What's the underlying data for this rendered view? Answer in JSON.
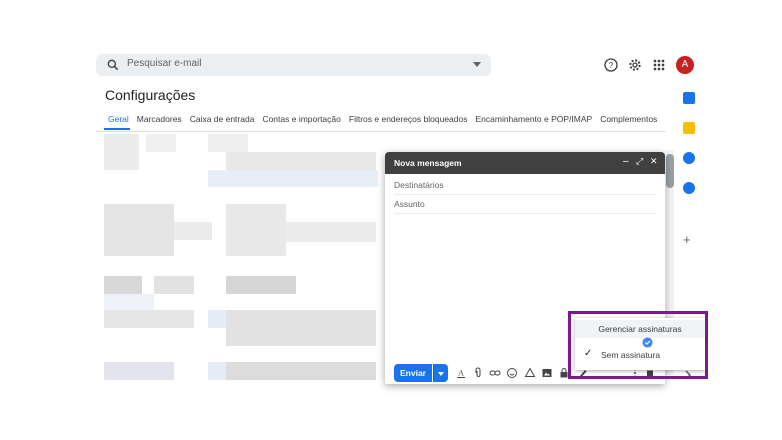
{
  "search": {
    "placeholder": "Pesquisar e-mail"
  },
  "header": {
    "avatar_letter": "A"
  },
  "page": {
    "title": "Configurações"
  },
  "tabs": [
    {
      "label": "Geral",
      "active": true
    },
    {
      "label": "Marcadores"
    },
    {
      "label": "Caixa de entrada"
    },
    {
      "label": "Contas e importação"
    },
    {
      "label": "Filtros e endereços bloqueados"
    },
    {
      "label": "Encaminhamento e POP/IMAP"
    },
    {
      "label": "Complementos"
    }
  ],
  "compose": {
    "title": "Nova mensagem",
    "to_label": "Destinatários",
    "subject_label": "Assunto",
    "send_label": "Enviar"
  },
  "signature_menu": {
    "manage_label": "Gerenciar assinaturas",
    "none_label": "Sem assinatura"
  },
  "colors": {
    "accent": "#1a73e8",
    "avatar": "#c5221f",
    "highlight": "#7b1a8c",
    "compose_header": "#404040"
  }
}
